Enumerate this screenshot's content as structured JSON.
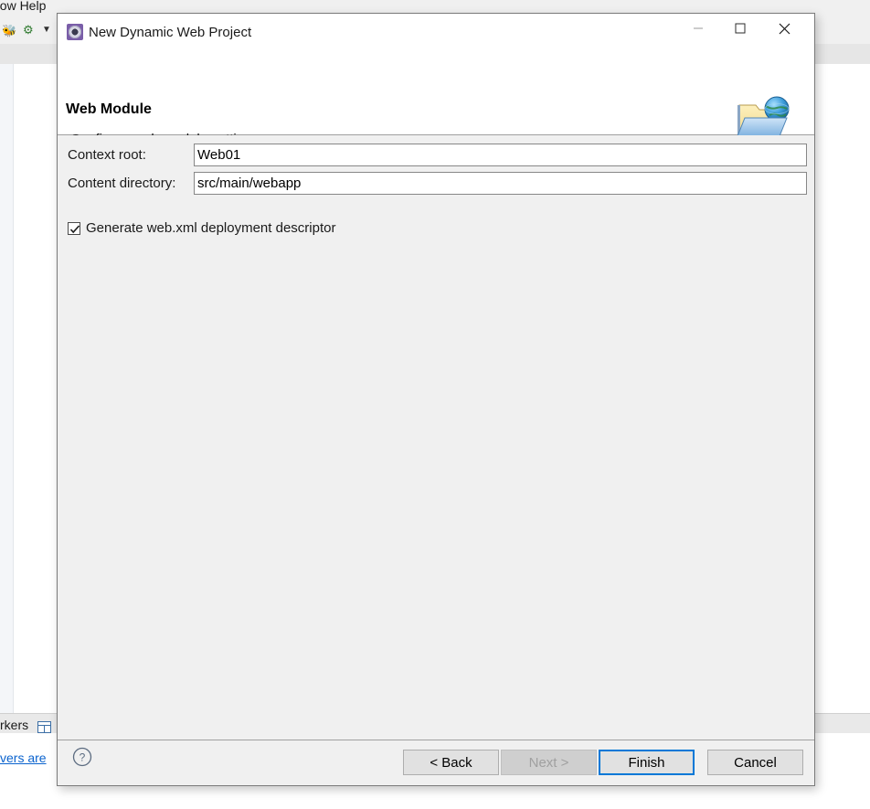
{
  "background": {
    "menu_tail": "dow  Help",
    "toolbar_icons": [
      "debug-icon",
      "run-icon",
      "dropdown-arrow-icon"
    ],
    "bottom_tab_label": "rkers",
    "bottom_tab_icon": "table-icon",
    "status_link": "vers are"
  },
  "dialog": {
    "title": "New Dynamic Web Project",
    "title_icon": "eclipse-wizard-icon",
    "window_controls": {
      "minimize": "minimize-icon",
      "maximize": "maximize-icon",
      "close": "close-icon"
    },
    "header": {
      "title": "Web Module",
      "description": "Configure web module settings.",
      "banner_icon": "web-folder-globe-icon"
    },
    "form": {
      "fields": [
        {
          "label": "Context root:",
          "value": "Web01",
          "placeholder": ""
        },
        {
          "label": "Content directory:",
          "value": "src/main/webapp",
          "placeholder": ""
        }
      ],
      "checkbox": {
        "label": "Generate web.xml deployment descriptor",
        "checked": true
      }
    },
    "footer": {
      "help_icon": "help-question-icon",
      "buttons": [
        {
          "label": "< Back",
          "enabled": true,
          "focused": false
        },
        {
          "label": "Next >",
          "enabled": false,
          "focused": false
        },
        {
          "label": "Finish",
          "enabled": true,
          "focused": true
        },
        {
          "label": "Cancel",
          "enabled": true,
          "focused": false
        }
      ]
    }
  },
  "colors": {
    "accent": "#0078d7",
    "dialog_bg": "#f0f0f0",
    "header_bg": "#ffffff",
    "link": "#0b63ce"
  }
}
